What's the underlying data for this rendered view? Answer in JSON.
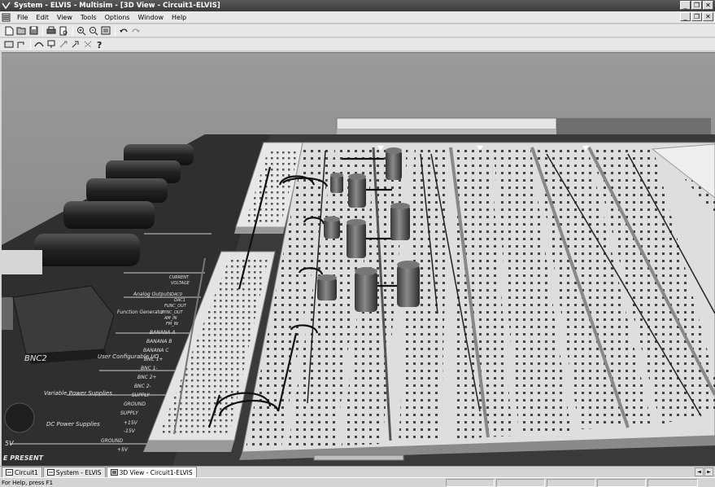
{
  "window": {
    "title": "System - ELVIS - Multisim - [3D View - Circuit1-ELVIS]",
    "minimize": "_",
    "restore": "❐",
    "close": "✕"
  },
  "menu": [
    {
      "id": "file",
      "label": "File"
    },
    {
      "id": "edit",
      "label": "Edit"
    },
    {
      "id": "view",
      "label": "View"
    },
    {
      "id": "tools",
      "label": "Tools"
    },
    {
      "id": "options",
      "label": "Options"
    },
    {
      "id": "window",
      "label": "Window"
    },
    {
      "id": "help",
      "label": "Help"
    }
  ],
  "toolbar1": [
    "new-icon",
    "open-icon",
    "save-icon",
    "print-icon",
    "print-preview-icon",
    "zoom-in-icon",
    "zoom-out-icon",
    "zoom-area-icon",
    "undo-icon",
    "redo-icon"
  ],
  "toolbar2": [
    "component-icon",
    "wire-icon",
    "measure-icon",
    "probe-icon",
    "tool-icon",
    "help-icon"
  ],
  "board": {
    "connector_label": "BNC2",
    "labels": [
      "User Configurable I/O",
      "Variable Power Supplies",
      "DC Power Supplies",
      "BANANA A",
      "BANANA B",
      "BANANA C",
      "BNC 1+",
      "BNC 1-",
      "BNC 2+",
      "BNC 2-",
      "SUPPLY",
      "GROUND",
      "SUPPLY",
      "+15V",
      "-15V",
      "GROUND",
      "+5V",
      "Function Generator",
      "Analog Outputs",
      "FUNC_OUT",
      "SYNC_OUT",
      "AM_IN",
      "FM_IN",
      "CURRENT",
      "VOLTAGE",
      "DAC0",
      "DAC1",
      "5V",
      "E PRESENT"
    ]
  },
  "tabs": [
    {
      "label": "Circuit1",
      "active": false
    },
    {
      "label": "System - ELVIS",
      "active": false
    },
    {
      "label": "3D View - Circuit1-ELVIS",
      "active": true
    }
  ],
  "tab_scroll": {
    "left": "◄",
    "right": "►"
  },
  "status": {
    "text": "For Help, press F1"
  }
}
